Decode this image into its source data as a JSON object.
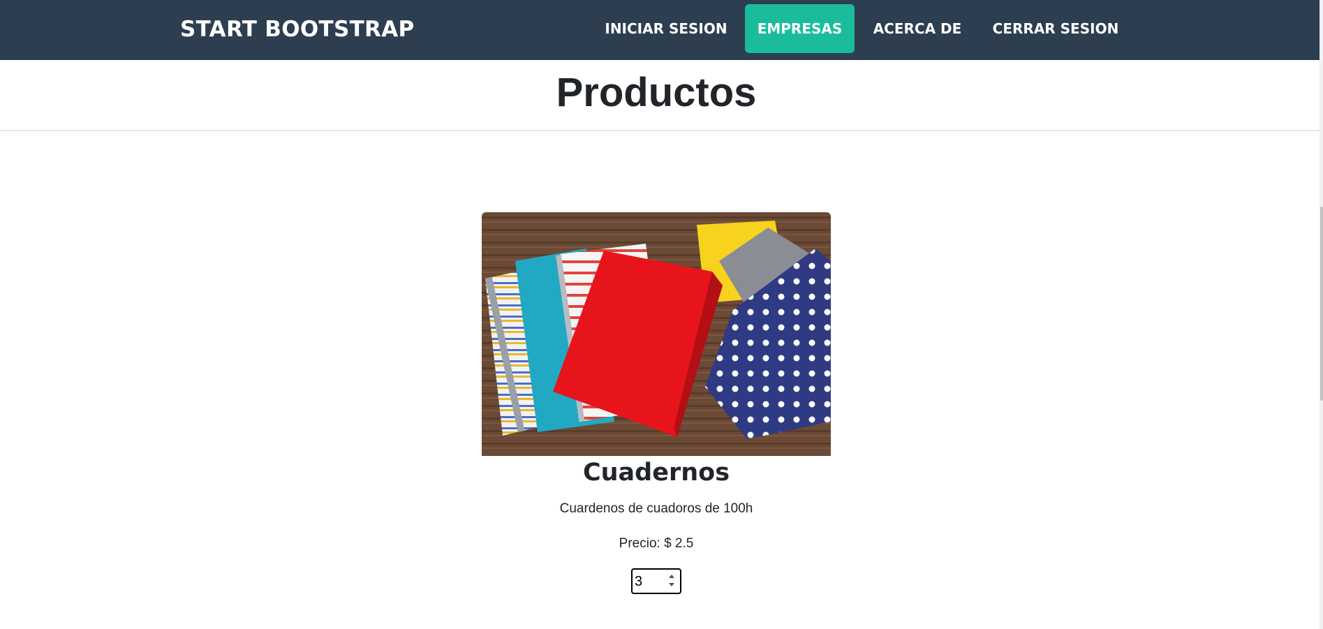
{
  "navbar": {
    "brand": "START BOOTSTRAP",
    "items": [
      {
        "label": "INICIAR SESION",
        "active": false
      },
      {
        "label": "EMPRESAS",
        "active": true
      },
      {
        "label": "ACERCA DE",
        "active": false
      },
      {
        "label": "CERRAR SESION",
        "active": false
      }
    ],
    "bg_color": "#2c3e50",
    "active_color": "#1abc9c"
  },
  "page": {
    "title": "Productos"
  },
  "product": {
    "image_icon": "notebooks-photo",
    "name": "Cuadernos",
    "description": "Cuardenos de cuadoros de 100h",
    "price_label": "Precio:",
    "price_value": "$ 2.5",
    "quantity": "3"
  }
}
